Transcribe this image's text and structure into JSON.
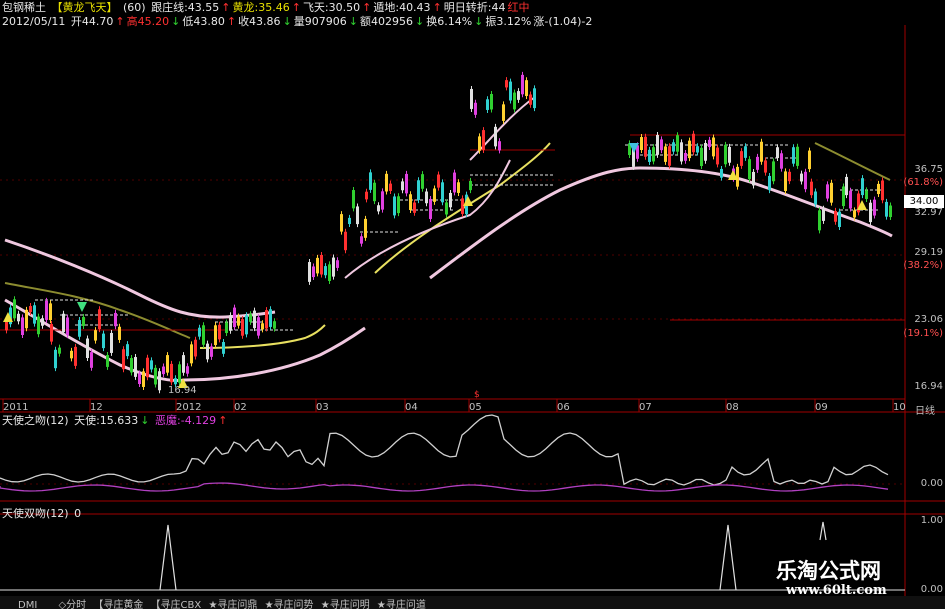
{
  "header": {
    "stock_name": "包钢稀土",
    "indicator_name": "【黄龙飞天】",
    "period": "(60)",
    "line1": [
      {
        "text": "跟庄线:43.55",
        "color": "white"
      },
      {
        "text": "↑",
        "color": "red"
      },
      {
        "text": "黄龙:35.46",
        "color": "yellow"
      },
      {
        "text": "↑",
        "color": "red"
      },
      {
        "text": "飞天:30.50",
        "color": "white"
      },
      {
        "text": "↑",
        "color": "red"
      },
      {
        "text": "遁地:40.43",
        "color": "white"
      },
      {
        "text": "↑",
        "color": "red"
      },
      {
        "text": "明日转折:44",
        "color": "white"
      },
      {
        "text": "红中",
        "color": "red"
      }
    ],
    "date": "2012/05/11",
    "line2": [
      {
        "text": "开44.70",
        "color": "white"
      },
      {
        "text": "↑",
        "color": "red"
      },
      {
        "text": "高45.20",
        "color": "red"
      },
      {
        "text": "↓",
        "color": "green"
      },
      {
        "text": "低43.80",
        "color": "white"
      },
      {
        "text": "↑",
        "color": "red"
      },
      {
        "text": "收43.86",
        "color": "white"
      },
      {
        "text": "↓",
        "color": "green"
      },
      {
        "text": "量907906",
        "color": "white"
      },
      {
        "text": "↓",
        "color": "green"
      },
      {
        "text": "额402956",
        "color": "white"
      },
      {
        "text": "↓",
        "color": "green"
      },
      {
        "text": "换6.14%",
        "color": "white"
      },
      {
        "text": "↓",
        "color": "green"
      },
      {
        "text": "振3.12%",
        "color": "white"
      },
      {
        "text": "涨-(1.04)-2",
        "color": "white"
      }
    ]
  },
  "price_axis": {
    "labels": [
      "36.75",
      "(61.8%)",
      "34.00",
      "32.97",
      "29.19",
      "(38.2%)",
      "23.06",
      "(19.1%)",
      "16.94"
    ],
    "current_price": "34.00"
  },
  "low_label": "16.94",
  "months": [
    "2011",
    "12",
    "2012",
    "02",
    "03",
    "04",
    "05",
    "06",
    "07",
    "08",
    "09",
    "10"
  ],
  "period_label": "日线",
  "indicator1": {
    "title": "天使之吻(12)",
    "v1": "天使:15.633",
    "arrow1": "↓",
    "v2": "恶魔:-4.129",
    "arrow2": "↑",
    "axis_top": "",
    "axis_zero": "0.00"
  },
  "indicator2": {
    "title": "天使双吻(12)",
    "value": "0",
    "axis_top": "1.00",
    "axis_zero": "0.00"
  },
  "tabs": [
    "DMI",
    "◇分时",
    "【寻庄黄金",
    "【寻庄CBX",
    "★寻庄问鼎",
    "★寻庄问势",
    "★寻庄问明",
    "★寻庄问道"
  ],
  "watermark": {
    "title": "乐淘公式网",
    "url": "www.60lt.com"
  },
  "colors": {
    "background": "#000000",
    "upper_band": "#f0c8e0",
    "lower_band": "#f0c8e0",
    "yellow_line": "#e8e060",
    "olive_line": "#909030",
    "angel_line": "#d0d0d0",
    "devil_line": "#b040c0",
    "grid_red": "#a00000"
  }
}
